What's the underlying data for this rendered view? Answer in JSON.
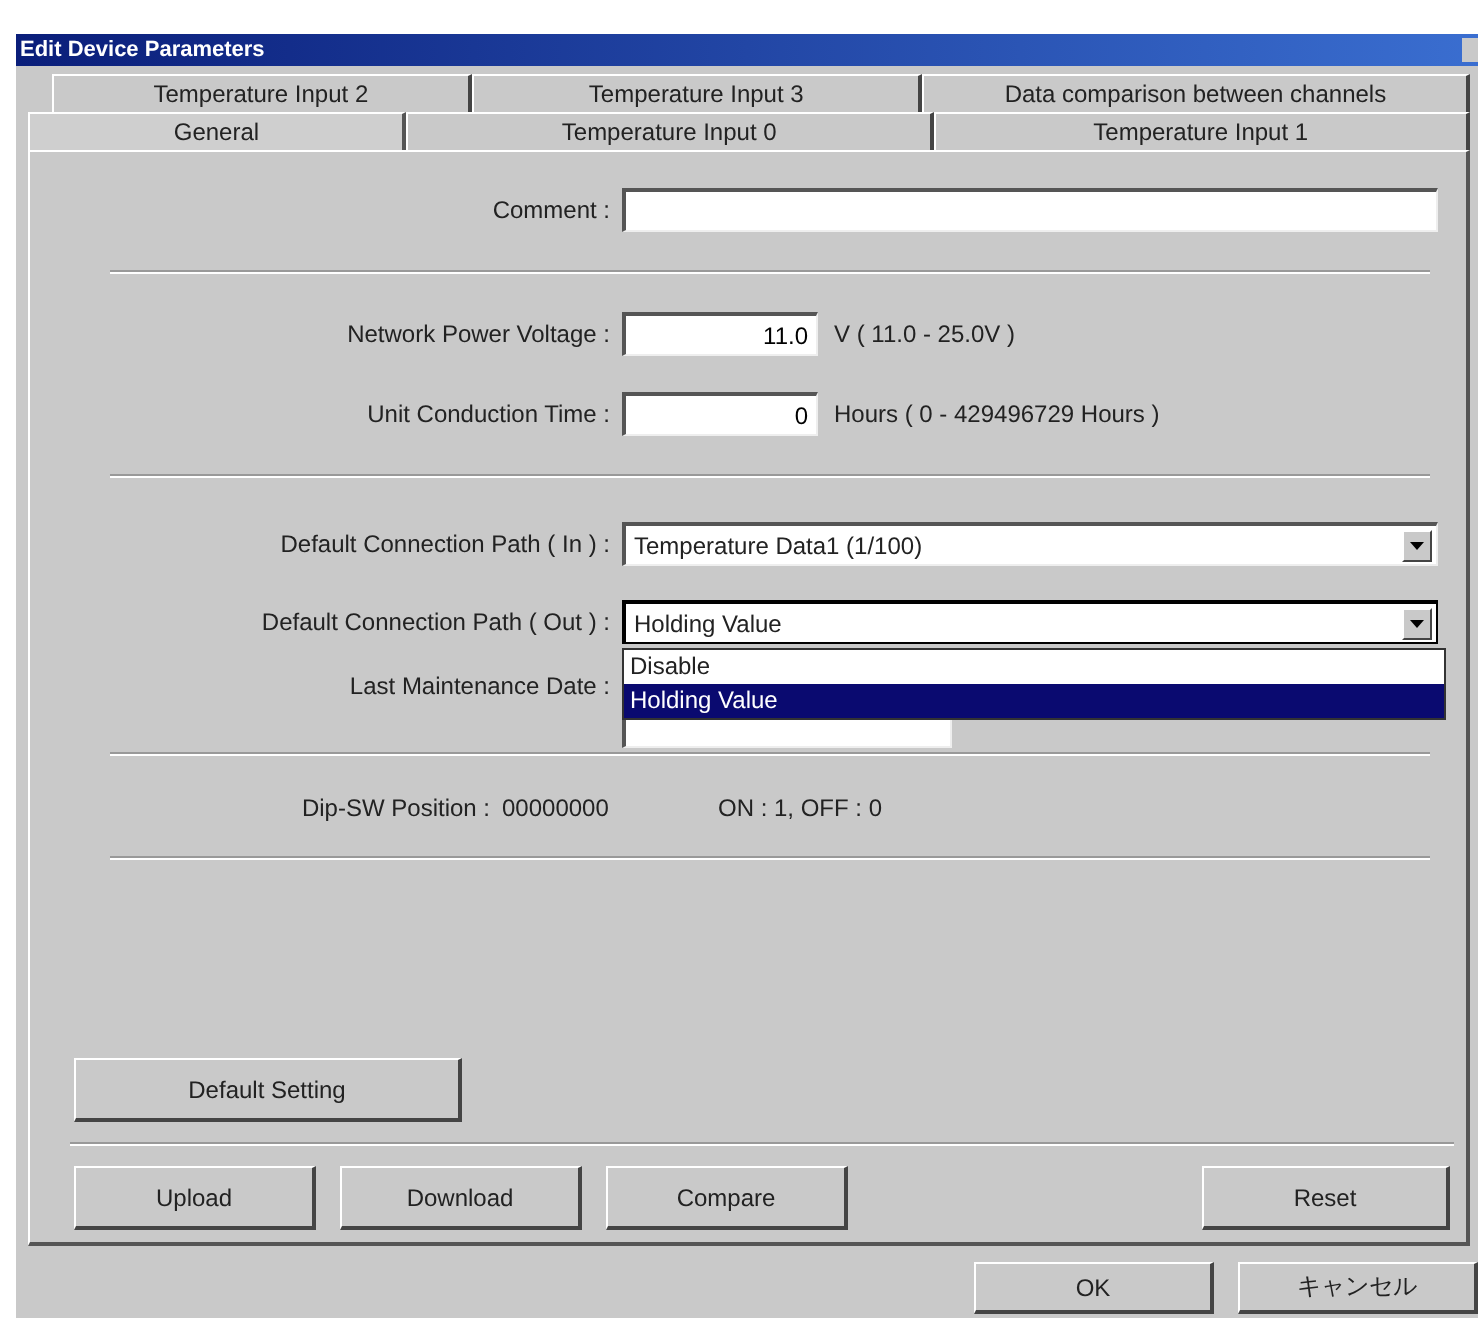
{
  "window": {
    "title": "Edit Device Parameters"
  },
  "tab_rows": [
    [
      {
        "label": "Temperature Input 2",
        "selected": false
      },
      {
        "label": "Temperature Input 3",
        "selected": false
      },
      {
        "label": "Data comparison between channels",
        "selected": false
      }
    ],
    [
      {
        "label": "General",
        "selected": true
      },
      {
        "label": "Temperature Input 0",
        "selected": false
      },
      {
        "label": "Temperature Input 1",
        "selected": false
      }
    ]
  ],
  "comment": {
    "label": "Comment :"
  },
  "network_power_voltage": {
    "label": "Network Power Voltage :",
    "value": "11.0",
    "range": "V ( 11.0 - 25.0V )"
  },
  "unit_conduction_time": {
    "label": "Unit Conduction Time :",
    "value": "0",
    "range": "Hours ( 0 - 429496729 Hours )"
  },
  "connection_path_in": {
    "label": "Default Connection Path ( In ) :",
    "value": "Temperature Data1 (1/100)"
  },
  "connection_path_out": {
    "label": "Default Connection Path ( Out ) :",
    "value": "Holding Value",
    "expanded": true,
    "options": [
      {
        "label": "Disable",
        "selected": false
      },
      {
        "label": "Holding Value",
        "selected": true
      }
    ]
  },
  "last_maintenance_date": {
    "label": "Last Maintenance Date :"
  },
  "dip_sw": {
    "label": "Dip-SW Position :",
    "value": "00000000",
    "legend": "ON : 1, OFF : 0"
  },
  "default_setting_button": "Default Setting",
  "action_buttons": [
    {
      "label": "Upload",
      "kind": "left"
    },
    {
      "label": "Download",
      "kind": "left"
    },
    {
      "label": "Compare",
      "kind": "left"
    },
    {
      "label": "Reset",
      "kind": "right"
    }
  ],
  "dialog_buttons": [
    "OK",
    "キャンセル"
  ]
}
